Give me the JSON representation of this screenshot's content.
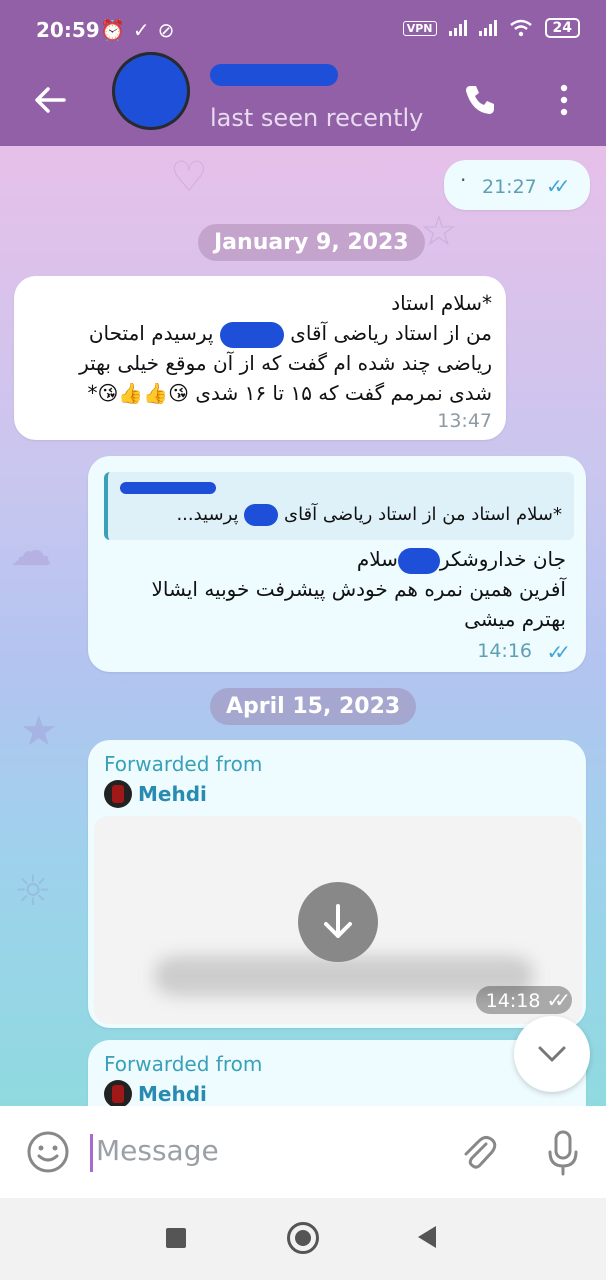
{
  "status_bar": {
    "time": "20:59",
    "vpn": "VPN",
    "battery": "24"
  },
  "header": {
    "status": "last seen recently"
  },
  "messages": {
    "first_time": "21:27",
    "date1": "January 9, 2023",
    "m1_line1": "*سلام استاد",
    "m1_line2a": "من از استاد ریاضی آقای",
    "m1_line2b": "پرسیدم امتحان",
    "m1_line3": "ریاضی چند شده ام گفت که از آن موقع خیلی بهتر",
    "m1_line4": "شدی نمرمم گفت که ۱۵ تا ۱۶ شدی",
    "m1_star": "*",
    "m1_time": "13:47",
    "reply_quote_a": "*سلام استاد من از استاد ریاضی آقای",
    "reply_quote_b": "پرسید...",
    "m2_line1a": "سلام",
    "m2_line1b": "جان خداروشکر",
    "m2_line2": "آفرین همین نمره هم خودش پیشرفت خوبیه ایشالا",
    "m2_line3": "بهترم میشی",
    "m2_time": "14:16",
    "date2": "April 15, 2023",
    "fwd_label": "Forwarded from",
    "fwd_name": "Mehdi",
    "media_time": "14:18",
    "fwd2_label": "Forwarded from",
    "fwd2_name": "Mehdi"
  },
  "input": {
    "placeholder": "Message"
  },
  "colors": {
    "header": "#9160a6",
    "accent": "#45a5d5",
    "redaction": "#1d4fd8"
  }
}
